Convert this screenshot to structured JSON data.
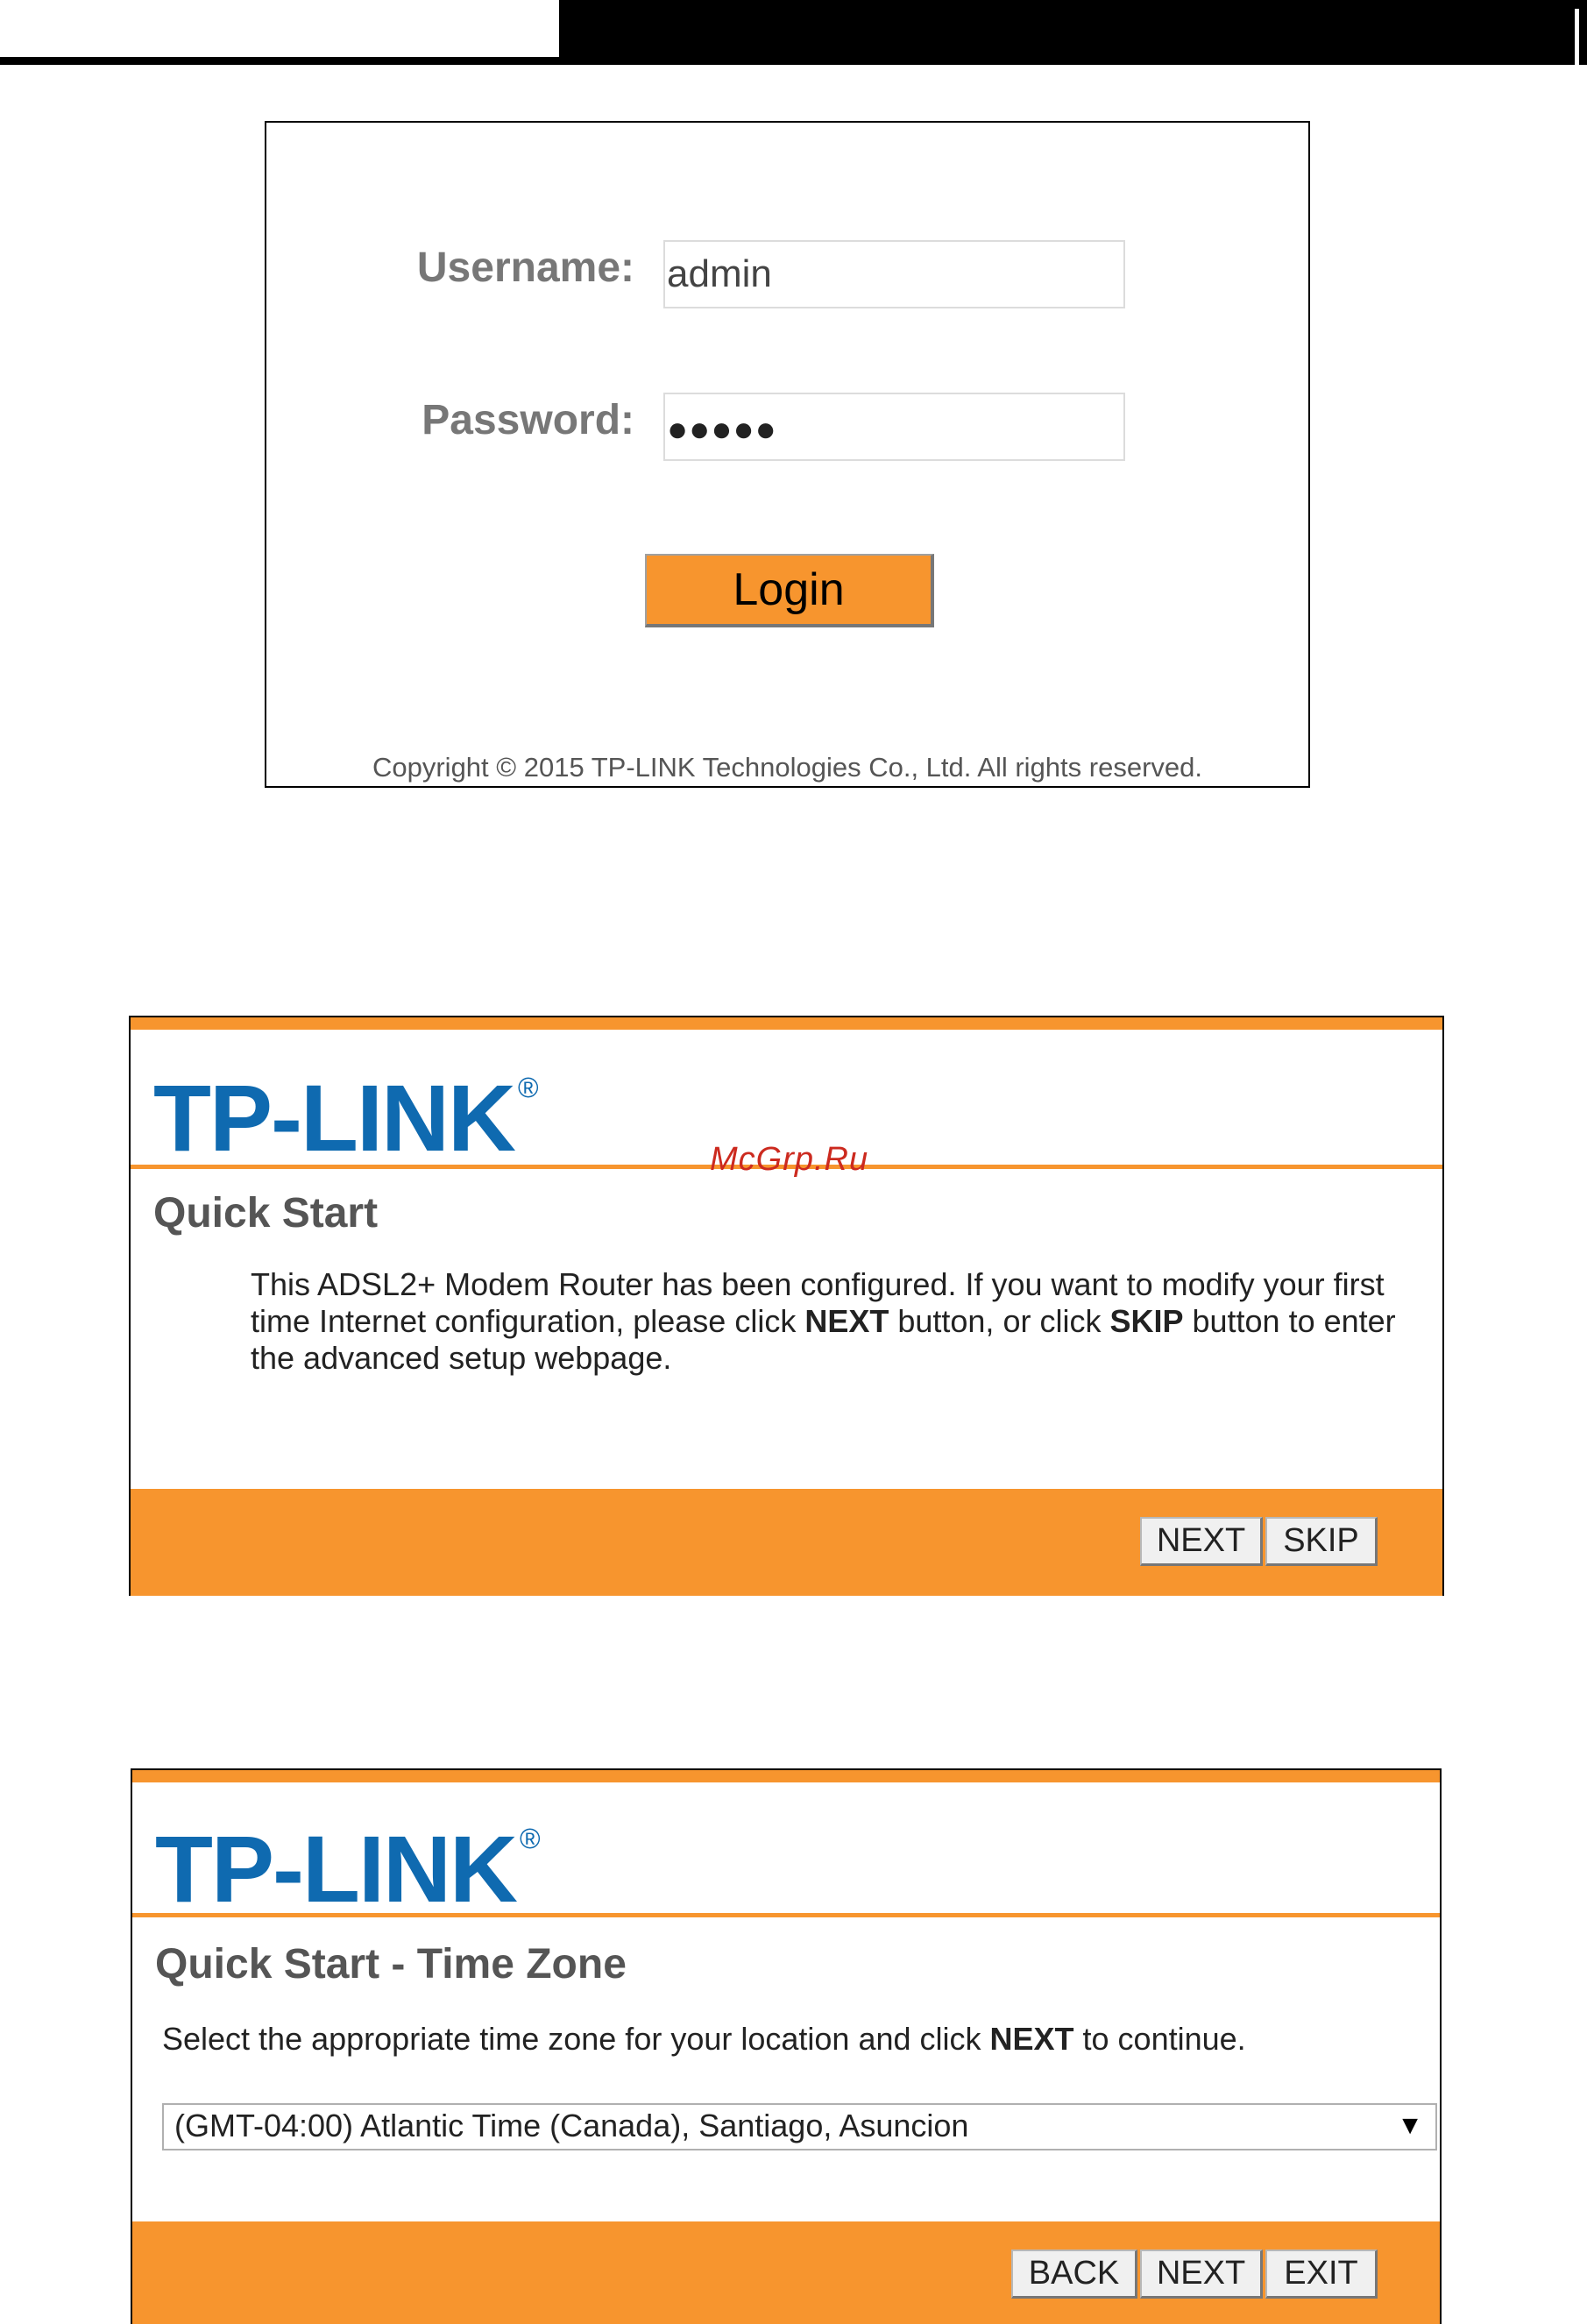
{
  "login": {
    "username_label": "Username:",
    "username_value": "admin",
    "password_label": "Password:",
    "password_value": "●●●●●",
    "login_button": "Login",
    "copyright": "Copyright © 2015 TP-LINK Technologies Co., Ltd. All rights reserved."
  },
  "quick_start": {
    "logo": "TP-LINK",
    "logo_mark": "®",
    "title": "Quick Start",
    "desc_part1": "This ADSL2+ Modem Router has been configured. If you want to modify your first time Internet configuration, please click ",
    "desc_next": "NEXT",
    "desc_part2": " button, or click ",
    "desc_skip": "SKIP",
    "desc_part3": " button to enter the advanced setup webpage.",
    "buttons": {
      "next": "NEXT",
      "skip": "SKIP"
    }
  },
  "time_zone": {
    "logo": "TP-LINK",
    "logo_mark": "®",
    "title": "Quick Start - Time Zone",
    "desc_part1": "Select the appropriate time zone for your location and click ",
    "desc_next": "NEXT",
    "desc_part2": " to continue.",
    "selected_zone": "(GMT-04:00) Atlantic Time (Canada), Santiago, Asuncion",
    "buttons": {
      "back": "BACK",
      "next": "NEXT",
      "exit": "EXIT"
    }
  },
  "watermark": "McGrp.Ru",
  "colors": {
    "accent": "#f7952e",
    "logo_blue": "#0f6ab0",
    "watermark": "#cc2a1f"
  }
}
